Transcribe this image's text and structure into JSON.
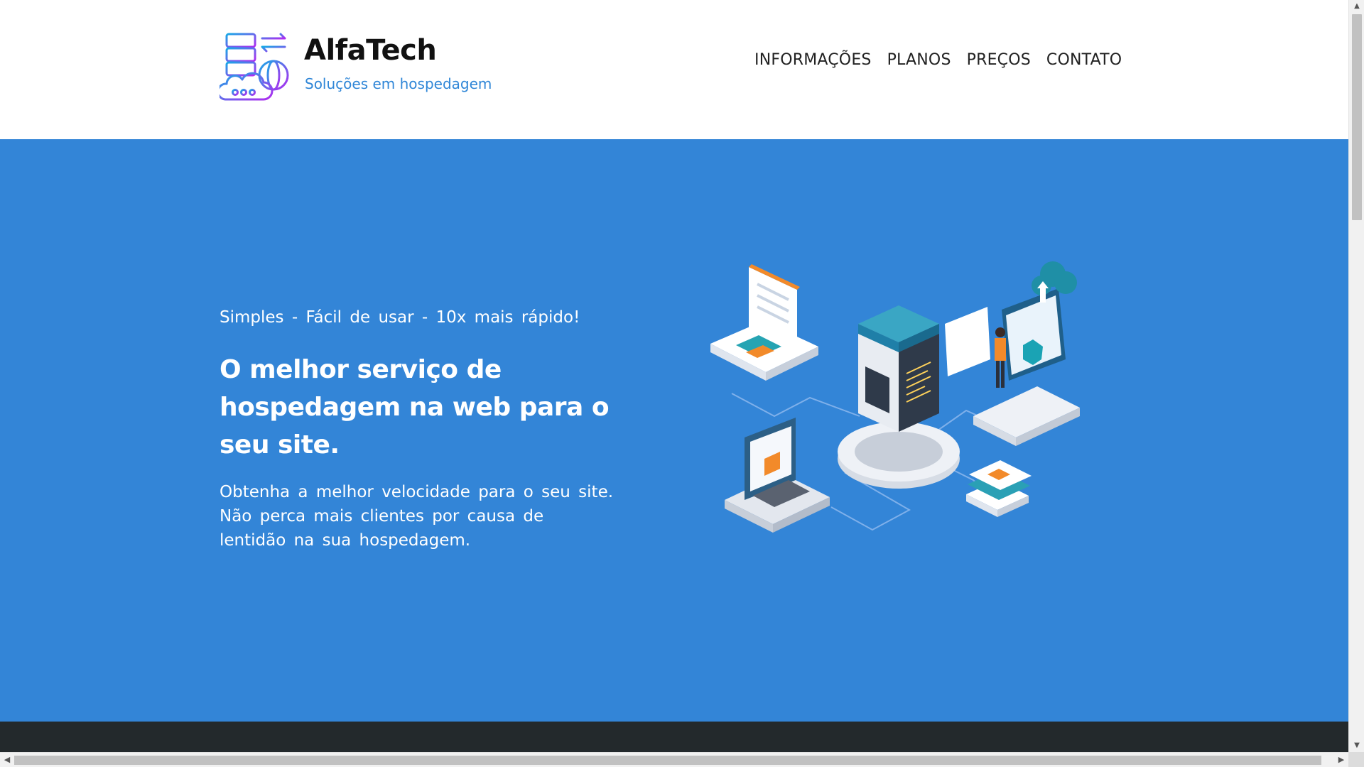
{
  "header": {
    "brand_title": "AlfaTech",
    "brand_subtitle": "Soluções em hospedagem",
    "nav": [
      {
        "label": "INFORMAÇÕES"
      },
      {
        "label": "PLANOS"
      },
      {
        "label": "PREÇOS"
      },
      {
        "label": "CONTATO"
      }
    ]
  },
  "hero": {
    "tagline": "Simples - Fácil de usar - 10x mais rápido!",
    "headline": "O melhor serviço de hospedagem na web para o seu site.",
    "description": "Obtenha a melhor velocidade para o seu site. Não perca mais clientes por causa de lentidão na sua hospedagem."
  },
  "colors": {
    "hero_bg": "#3385d7",
    "brand_accent": "#2f86d7",
    "footer_bg": "#23292c",
    "logo_gradient_start": "#18a9e6",
    "logo_gradient_end": "#b12bf0"
  },
  "icons": {
    "logo": "server-cloud-globe-icon",
    "illustration": "isometric-hosting-illustration"
  }
}
